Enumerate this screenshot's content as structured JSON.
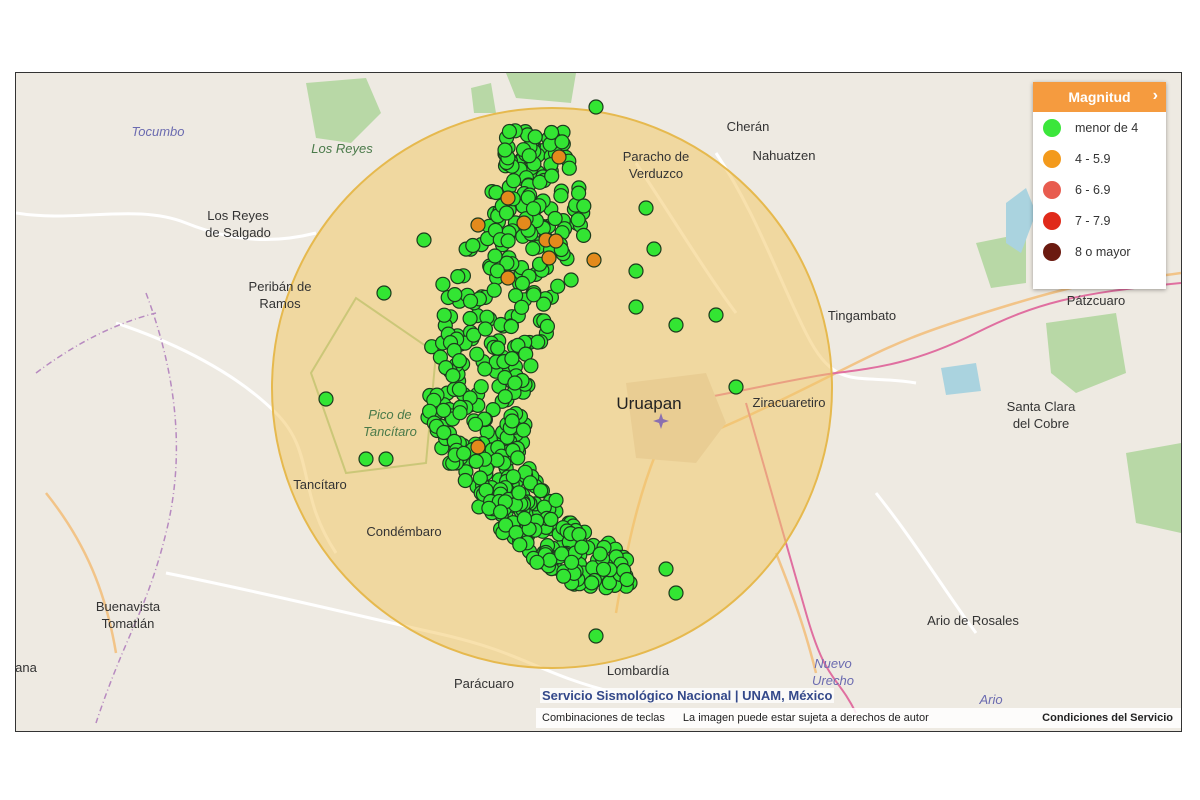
{
  "map": {
    "places": [
      {
        "name": "Tocumbo",
        "style": "italic"
      },
      {
        "name": "Los Reyes",
        "style": "green"
      },
      {
        "name": "Los Reyes\nde Salgado",
        "style": "normal"
      },
      {
        "name": "Peribán de\nRamos",
        "style": "normal"
      },
      {
        "name": "Pico de\nTancítaro",
        "style": "green"
      },
      {
        "name": "Tancítaro",
        "style": "normal"
      },
      {
        "name": "Condémbaro",
        "style": "normal"
      },
      {
        "name": "Buenavista\nTomatlán",
        "style": "normal"
      },
      {
        "name": "ana",
        "style": "normal"
      },
      {
        "name": "Parácuaro",
        "style": "normal"
      },
      {
        "name": "Lombardía",
        "style": "normal"
      },
      {
        "name": "Nuevo\nUrecho",
        "style": "italic"
      },
      {
        "name": "Ario",
        "style": "italic"
      },
      {
        "name": "Ario de Rosales",
        "style": "normal"
      },
      {
        "name": "Santa Clara\ndel Cobre",
        "style": "normal"
      },
      {
        "name": "Pátzcuaro",
        "style": "normal"
      },
      {
        "name": "Tingambato",
        "style": "normal"
      },
      {
        "name": "Ziracuaretiro",
        "style": "normal"
      },
      {
        "name": "Uruapan",
        "style": "big"
      },
      {
        "name": "Nahuatzen",
        "style": "normal"
      },
      {
        "name": "Cherán",
        "style": "normal"
      },
      {
        "name": "Paracho de\nVerduzco",
        "style": "normal"
      }
    ],
    "colors": {
      "background": "#eeeae2",
      "radius_circle_fill": "#f3c96a",
      "radius_circle_stroke": "#e6b94e",
      "quake_under_4": "#33e533",
      "quake_4_5_9": "#e38a1c"
    },
    "icons": [
      "airport-icon"
    ]
  },
  "legend": {
    "title": "Magnitud",
    "items": [
      {
        "label": "menor de 4",
        "color": "#3be63b"
      },
      {
        "label": "4 - 5.9",
        "color": "#f39a1c"
      },
      {
        "label": "6 - 6.9",
        "color": "#e85c4f"
      },
      {
        "label": "7 - 7.9",
        "color": "#e02a1a"
      },
      {
        "label": "8 o mayor",
        "color": "#6b1a10"
      }
    ]
  },
  "attribution": {
    "title": "Servicio Sismológico Nacional | UNAM, México",
    "shortcuts": "Combinaciones de teclas",
    "copyright": "La imagen puede estar sujeta a derechos de autor",
    "terms": "Condiciones del Servicio"
  }
}
